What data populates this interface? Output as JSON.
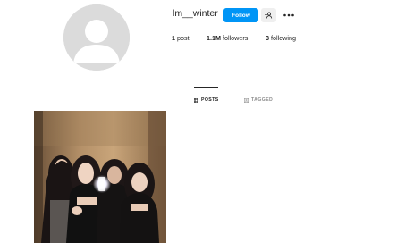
{
  "profile": {
    "username": "lm__winter",
    "follow_label": "Follow"
  },
  "stats": {
    "posts_count": "1",
    "posts_label": "post",
    "followers_count": "1.1M",
    "followers_label": "followers",
    "following_count": "3",
    "following_label": "following"
  },
  "tabs": [
    {
      "label": "POSTS",
      "icon": "grid-icon",
      "active": true
    },
    {
      "label": "TAGGED",
      "icon": "tag-icon",
      "active": false
    }
  ],
  "icons": {
    "suggest": "add-person-icon",
    "more": "more-options-icon",
    "avatar": "default-avatar-icon"
  },
  "colors": {
    "follow_button": "#0095f6",
    "secondary_button": "#efefef",
    "divider": "#dbdbdb",
    "text": "#262626",
    "muted_text": "#8e8e8e"
  }
}
